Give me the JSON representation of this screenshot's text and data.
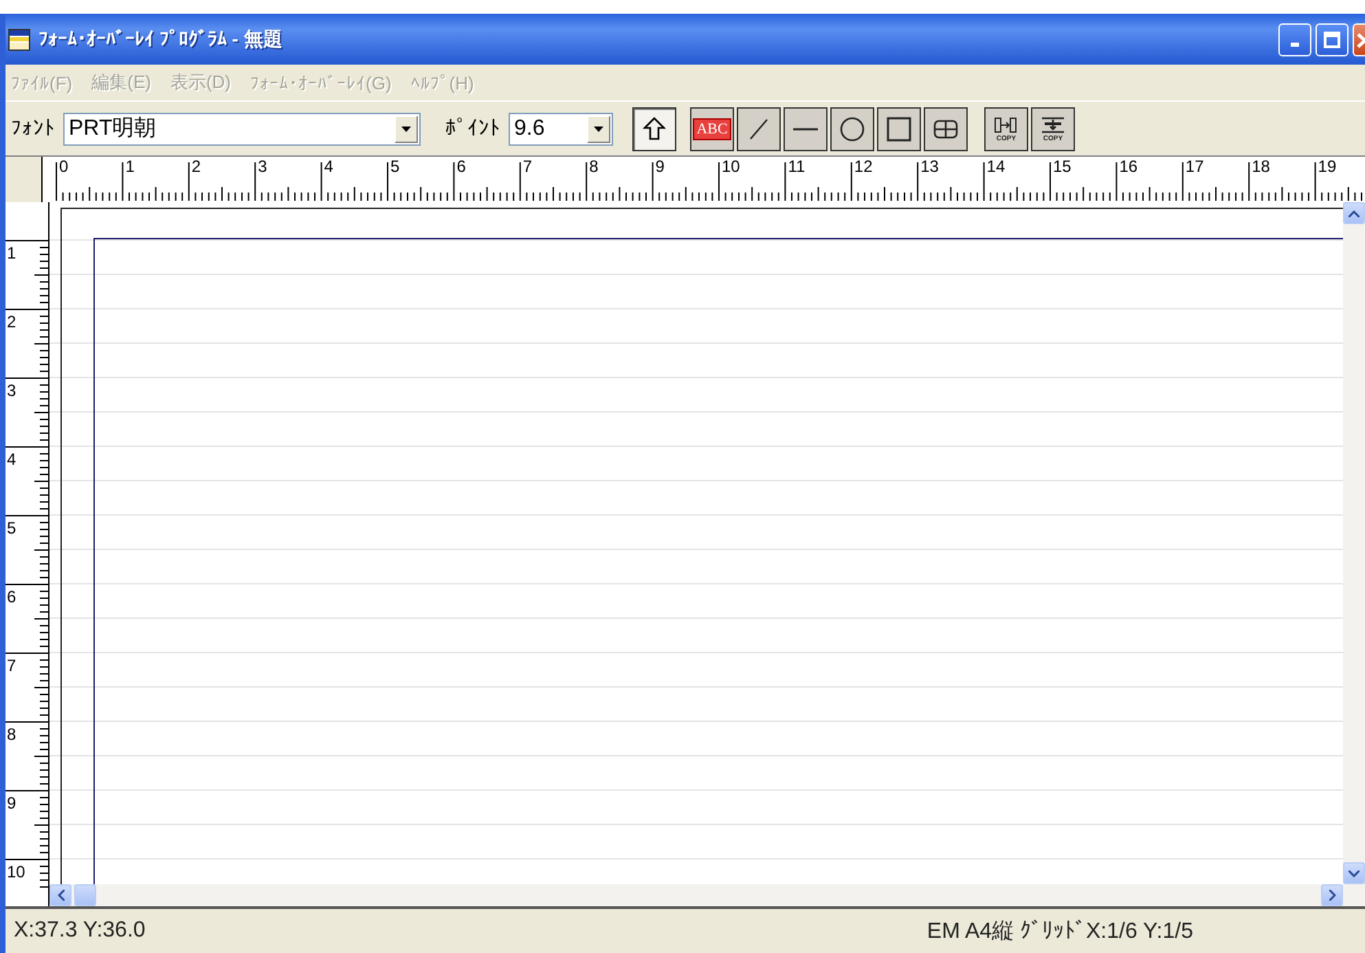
{
  "window": {
    "title": "ﾌｫｰﾑ･ｵｰﾊﾞｰﾚｲ ﾌﾟﾛｸﾞﾗﾑ - 無題"
  },
  "menu": [
    {
      "label": "ﾌｧｲﾙ(F)",
      "disabled": true
    },
    {
      "label": "編集(E)",
      "disabled": true
    },
    {
      "label": "表示(D)",
      "disabled": true
    },
    {
      "label": "ﾌｫｰﾑ･ｵｰﾊﾞｰﾚｲ(G)",
      "disabled": true
    },
    {
      "label": "ﾍﾙﾌﾟ(H)",
      "disabled": true
    }
  ],
  "toolbar": {
    "font_label": "ﾌｫﾝﾄ",
    "font_value": "PRT明朝",
    "point_label": "ﾎﾟｲﾝﾄ",
    "point_value": "9.6",
    "tools": [
      {
        "kind": "pointer",
        "selected": true
      },
      {
        "kind": "text",
        "label": "ABC",
        "selected": false
      },
      {
        "kind": "line",
        "selected": false
      },
      {
        "kind": "hline",
        "selected": false
      },
      {
        "kind": "circle",
        "selected": false
      },
      {
        "kind": "rect",
        "selected": false
      },
      {
        "kind": "grid",
        "selected": false
      },
      {
        "kind": "copy-h",
        "label": "COPY",
        "selected": false
      },
      {
        "kind": "copy-v",
        "label": "COPY",
        "selected": false
      }
    ]
  },
  "h_ruler": [
    "0",
    "1",
    "2",
    "3",
    "4",
    "5",
    "6",
    "7",
    "8",
    "9",
    "10",
    "11",
    "12",
    "13",
    "14",
    "15",
    "16",
    "17",
    "18",
    "19"
  ],
  "v_ruler": [
    "1",
    "2",
    "3",
    "4",
    "5",
    "6",
    "7",
    "8",
    "9",
    "10"
  ],
  "status_bar": {
    "position": "X:37.3 Y:36.0",
    "info": "EM A4縦 ｸﾞﾘｯﾄﾞX:1/6 Y:1/5"
  }
}
